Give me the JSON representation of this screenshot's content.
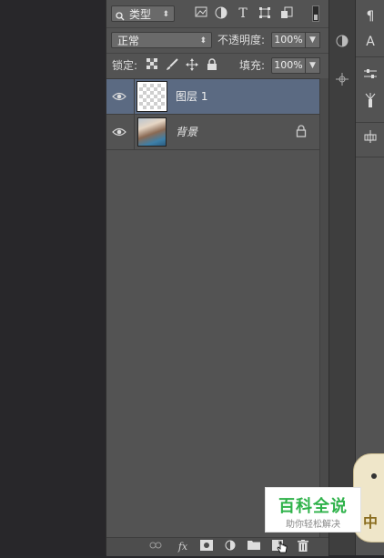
{
  "layers_panel": {
    "filter": {
      "kind_label": "类型",
      "search_icon": "search-icon"
    },
    "filter_icons": [
      "pixel-filter-icon",
      "adjustment-filter-icon",
      "text-filter-icon",
      "shape-filter-icon",
      "smart-object-filter-icon",
      "filter-toggle-icon"
    ],
    "blend_mode": "正常",
    "opacity_label": "不透明度:",
    "opacity_value": "100%",
    "lock_label": "锁定:",
    "lock_icons": [
      "lock-transparent-icon",
      "lock-paint-icon",
      "lock-move-icon",
      "lock-all-icon"
    ],
    "fill_label": "填充:",
    "fill_value": "100%",
    "layers": [
      {
        "name": "图层 1",
        "selected": true,
        "visible": true,
        "thumbnail": "transparent",
        "locked": false
      },
      {
        "name": "背景",
        "selected": false,
        "visible": true,
        "thumbnail": "photo",
        "locked": true
      }
    ],
    "bottom_icons": [
      "link-layers-icon",
      "fx-icon",
      "add-mask-icon",
      "adjustment-layer-icon",
      "new-group-icon",
      "new-layer-icon",
      "delete-icon"
    ],
    "bottom_fx_label": "fx"
  },
  "watermark": {
    "title": "百科全说",
    "subtitle": "助你轻松解决"
  },
  "mascot_char": "中",
  "colors": {
    "panel": "#535353",
    "selected_row": "#5b6a82",
    "watermark_green": "#2fb24a"
  }
}
